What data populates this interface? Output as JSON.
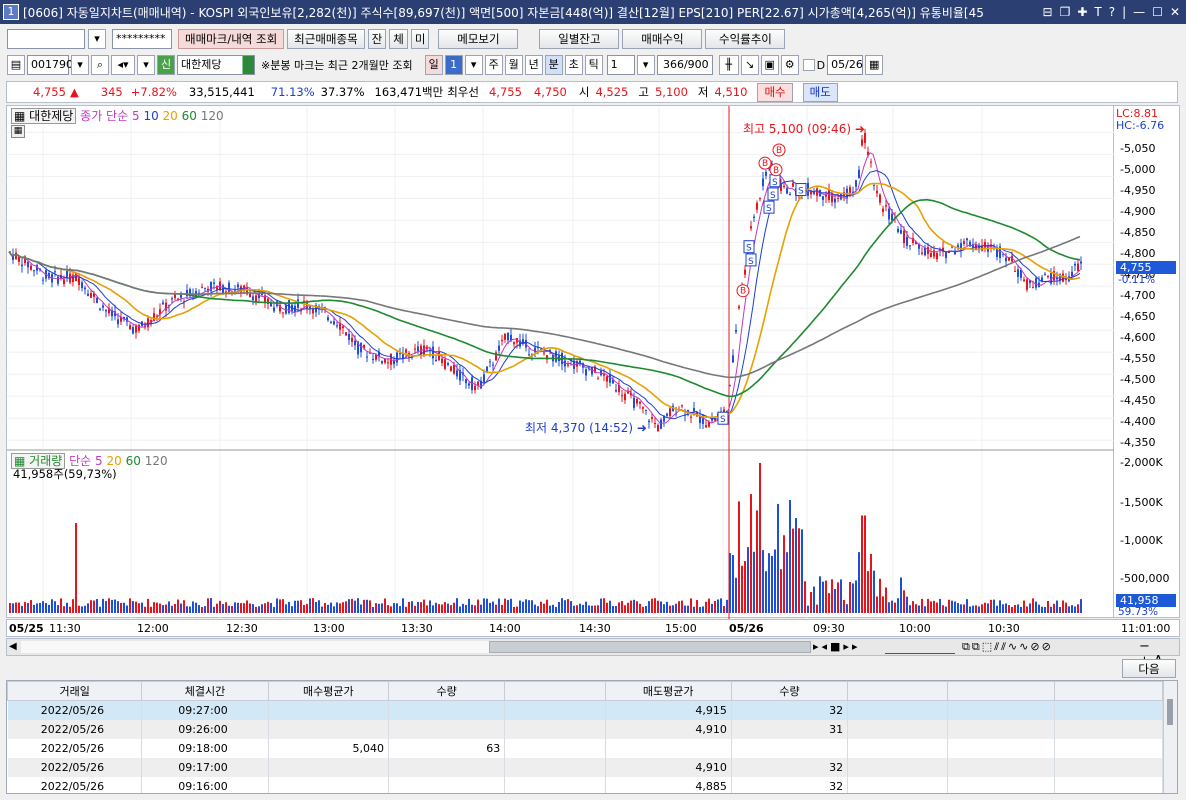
{
  "window": {
    "number": "1",
    "title": "[0606] 자동일지차트(매매내역) - KOSPI 외국인보유[2,282(천)] 주식수[89,697(천)] 액면[500] 자본금[448(억)] 결산[12월] EPS[210] PER[22.67] 시가총액[4,265(억)] 유통비율[45"
  },
  "toolbar1": {
    "account_value": "",
    "password_value": "*********",
    "btn_mark": "매매마크/내역 조회",
    "btn_recent": "최근매매종목",
    "btn_jan": "잔",
    "btn_che": "체",
    "btn_mi": "미",
    "btn_memo": "메모보기",
    "btn_daily": "일별잔고",
    "btn_profit": "매매수익",
    "btn_return": "수익률추이"
  },
  "toolbar2": {
    "code": "001790",
    "badge": "신",
    "stock_name": "대한제당",
    "note": "※분봉 마크는 최근 2개월만 조회",
    "period_day": "일",
    "period_num": "1",
    "period_week": "주",
    "period_month": "월",
    "period_year": "년",
    "period_min": "분",
    "period_sec": "초",
    "period_tick": "틱",
    "interval": "1",
    "count": "366/900",
    "date_chk": "D",
    "date": "05/26"
  },
  "quote": {
    "price": "4,755",
    "change": "345",
    "rate": "+7.82%",
    "volume": "33,515,441",
    "vol_ratio": "71.13%",
    "turnover": "37.37%",
    "amount": "163,471백만",
    "best_label": "최우선",
    "ask": "4,755",
    "bid": "4,750",
    "open_label": "시",
    "open": "4,525",
    "high_label": "고",
    "high": "5,100",
    "low_label": "저",
    "low": "4,510",
    "buy_btn": "매수",
    "sell_btn": "매도"
  },
  "legend": {
    "stock": "대한제당",
    "price_label": "종가 단순",
    "ma": [
      "5",
      "10",
      "20",
      "60",
      "120"
    ],
    "vol_label": "거래량",
    "vol_type": "단순",
    "vol_ma": [
      "5",
      "20",
      "60",
      "120"
    ],
    "vol_value": "41,958주(59,73%)"
  },
  "annotations": {
    "high": "최고 5,100 (09:46)",
    "low": "최저 4,370 (14:52)",
    "lc": "LC:8.81",
    "hc": "HC:-6.76",
    "price_tag": "4,755",
    "price_pct": "-0.11%",
    "vol_tag": "41,958",
    "vol_pct": "59.73%"
  },
  "price_axis": [
    "5,050",
    "5,000",
    "4,950",
    "4,900",
    "4,850",
    "4,800",
    "4,750",
    "4,700",
    "4,650",
    "4,600",
    "4,550",
    "4,500",
    "4,450",
    "4,400",
    "4,350"
  ],
  "volume_axis": [
    "2,000K",
    "1,500K",
    "1,000K",
    "500,000"
  ],
  "time_axis": [
    "05/25",
    "11:30",
    "12:00",
    "12:30",
    "13:00",
    "13:30",
    "14:00",
    "14:30",
    "15:00",
    "05/26",
    "09:30",
    "10:00",
    "10:30",
    "11:01:00"
  ],
  "next_btn": "다음",
  "table": {
    "headers": [
      "거래일",
      "체결시간",
      "매수평균가",
      "수량",
      "",
      "매도평균가",
      "수량",
      "",
      "",
      ""
    ],
    "rows": [
      [
        "2022/05/26",
        "09:27:00",
        "",
        "",
        "",
        "4,915",
        "32",
        "",
        "",
        ""
      ],
      [
        "2022/05/26",
        "09:26:00",
        "",
        "",
        "",
        "4,910",
        "31",
        "",
        "",
        ""
      ],
      [
        "2022/05/26",
        "09:18:00",
        "5,040",
        "63",
        "",
        "",
        "",
        "",
        "",
        ""
      ],
      [
        "2022/05/26",
        "09:17:00",
        "",
        "",
        "",
        "4,910",
        "32",
        "",
        "",
        ""
      ],
      [
        "2022/05/26",
        "09:16:00",
        "",
        "",
        "",
        "4,885",
        "32",
        "",
        "",
        ""
      ]
    ]
  },
  "chart_data": {
    "type": "candlestick",
    "ylim": [
      4330,
      5110
    ],
    "sessions": [
      "05/25",
      "05/26"
    ],
    "marks_sell": [
      "S",
      "S",
      "S",
      "S",
      "S",
      "S",
      "S"
    ],
    "marks_buy": [
      "B",
      "B",
      "B",
      "B"
    ],
    "high": 5100,
    "low": 4370
  },
  "colors": {
    "up": "#e8141b",
    "down": "#1d4fd8",
    "ma5": "#c03ac0",
    "ma10": "#1a3fd0",
    "ma20": "#e6a100",
    "ma60": "#1e8a2e",
    "ma120": "#777777"
  }
}
